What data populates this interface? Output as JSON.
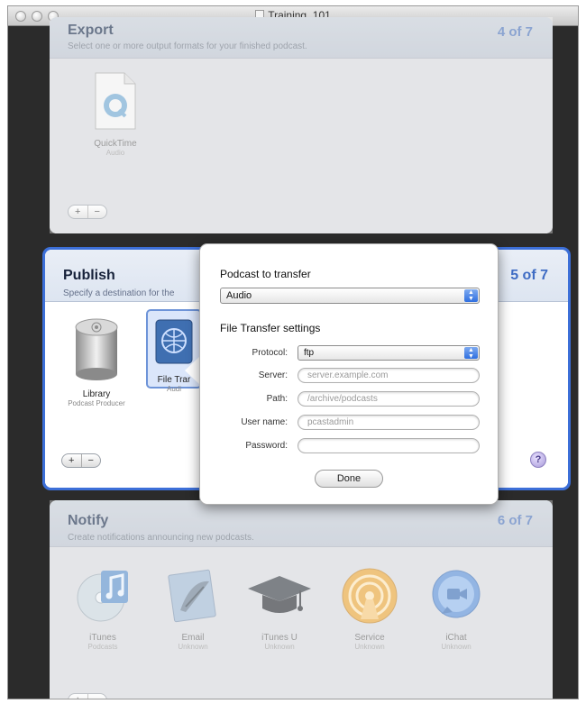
{
  "window": {
    "title": "Training_101"
  },
  "export_panel": {
    "title": "Export",
    "subtitle": "Select one or more output formats for your finished podcast.",
    "step": "4 of 7",
    "items": [
      {
        "label": "QuickTime",
        "sub": "Audio",
        "icon": "quicktime-icon"
      }
    ],
    "add_label": "+",
    "remove_label": "−"
  },
  "publish_panel": {
    "title": "Publish",
    "subtitle": "Specify a destination for the",
    "step": "5 of 7",
    "items": [
      {
        "label": "Library",
        "sub": "Podcast Producer",
        "icon": "library-icon"
      },
      {
        "label": "File Trar",
        "sub": "Audi",
        "icon": "file-transfer-icon"
      }
    ],
    "add_label": "+",
    "remove_label": "−",
    "help_label": "?"
  },
  "popover": {
    "podcast_heading": "Podcast to transfer",
    "podcast_value": "Audio",
    "settings_heading": "File Transfer settings",
    "protocol_label": "Protocol:",
    "protocol_value": "ftp",
    "server_label": "Server:",
    "server_placeholder": "server.example.com",
    "path_label": "Path:",
    "path_placeholder": "/archive/podcasts",
    "username_label": "User name:",
    "username_placeholder": "pcastadmin",
    "password_label": "Password:",
    "password_placeholder": "",
    "done_label": "Done"
  },
  "notify_panel": {
    "title": "Notify",
    "subtitle": "Create notifications announcing new podcasts.",
    "step": "6 of 7",
    "items": [
      {
        "label": "iTunes",
        "sub": "Podcasts",
        "icon": "itunes-icon"
      },
      {
        "label": "Email",
        "sub": "Unknown",
        "icon": "email-icon"
      },
      {
        "label": "iTunes U",
        "sub": "Unknown",
        "icon": "itunes-u-icon"
      },
      {
        "label": "Service",
        "sub": "Unknown",
        "icon": "service-icon"
      },
      {
        "label": "iChat",
        "sub": "Unknown",
        "icon": "ichat-icon"
      }
    ],
    "add_label": "+",
    "remove_label": "−"
  }
}
